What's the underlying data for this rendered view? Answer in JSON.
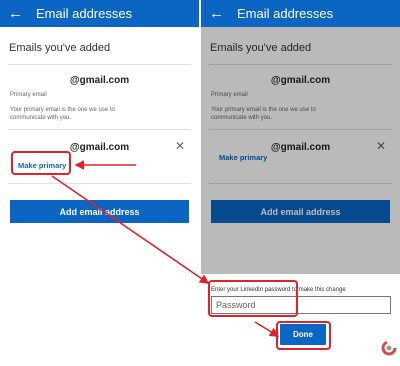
{
  "left": {
    "app_bar": {
      "back_icon": "back-arrow-icon",
      "title": "Email addresses"
    },
    "section_title": "Emails you've added",
    "primary_email": {
      "address": "@gmail.com",
      "label": "Primary email",
      "description": "Your primary email is the one we use to communicate with you."
    },
    "secondary_email": {
      "address": "@gmail.com",
      "close_icon": "close-x-icon",
      "close_glyph": "✕",
      "make_primary_label": "Make primary"
    },
    "add_button_label": "Add email address"
  },
  "right": {
    "app_bar": {
      "back_icon": "back-arrow-icon",
      "title": "Email addresses"
    },
    "section_title": "Emails you've added",
    "primary_email": {
      "address": "@gmail.com",
      "label": "Primary email",
      "description": "Your primary email is the one we use to communicate with you."
    },
    "secondary_email": {
      "address": "@gmail.com",
      "close_glyph": "✕",
      "make_primary_label": "Make primary"
    },
    "add_button_label": "Add email address",
    "password_prompt": "Enter your LinkedIn password to make this change",
    "password_placeholder": "Password",
    "done_label": "Done"
  },
  "colors": {
    "linkedin_blue": "#0a66c2",
    "annotation_red": "#e0232a",
    "overlay": "rgba(0,0,0,0.27)"
  },
  "watermark_icon": "logo-icon"
}
